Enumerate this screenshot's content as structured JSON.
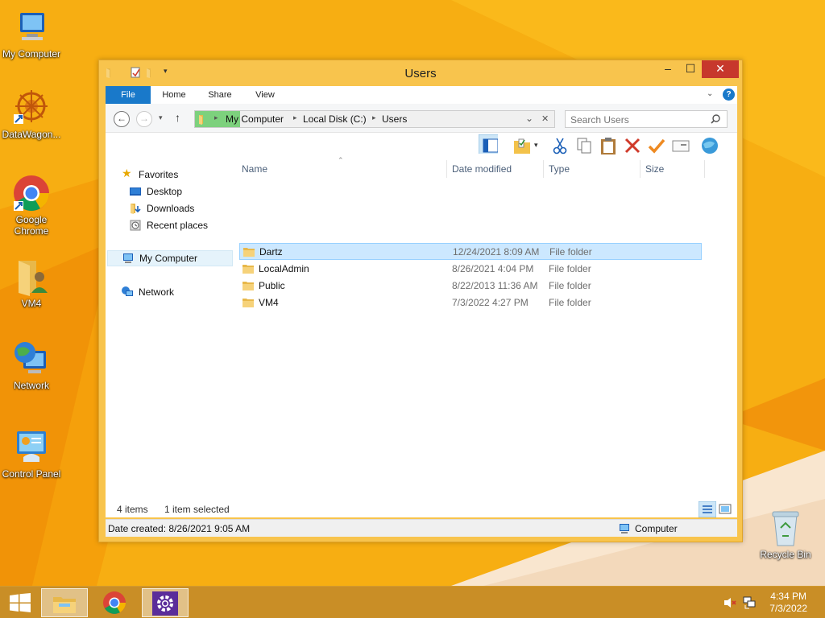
{
  "desktop": {
    "icons": [
      {
        "label": "My Computer",
        "icon": "computer-icon"
      },
      {
        "label": "DataWagon...",
        "icon": "datawagon-icon"
      },
      {
        "label": "Google Chrome",
        "icon": "chrome-icon"
      },
      {
        "label": "VM4",
        "icon": "user-folder-icon"
      },
      {
        "label": "Network",
        "icon": "network-icon"
      },
      {
        "label": "Control Panel",
        "icon": "control-panel-icon"
      },
      {
        "label": "Recycle Bin",
        "icon": "recycle-bin-icon"
      }
    ]
  },
  "window": {
    "title": "Users",
    "ribbon_tabs": [
      "File",
      "Home",
      "Share",
      "View"
    ],
    "address": {
      "crumbs": [
        "My Computer",
        "Local Disk (C:)",
        "Users"
      ]
    },
    "search": {
      "placeholder": "Search Users"
    },
    "nav_pane": {
      "favorites": "Favorites",
      "desktop": "Desktop",
      "downloads": "Downloads",
      "recent": "Recent places",
      "my_computer": "My Computer",
      "network": "Network"
    },
    "columns": [
      "Name",
      "Date modified",
      "Type",
      "Size"
    ],
    "rows": [
      {
        "name": "Dartz",
        "date": "12/24/2021 8:09 AM",
        "type": "File folder",
        "selected": true
      },
      {
        "name": "LocalAdmin",
        "date": "8/26/2021 4:04 PM",
        "type": "File folder",
        "selected": false
      },
      {
        "name": "Public",
        "date": "8/22/2013 11:36 AM",
        "type": "File folder",
        "selected": false
      },
      {
        "name": "VM4",
        "date": "7/3/2022 4:27 PM",
        "type": "File folder",
        "selected": false
      }
    ],
    "status": {
      "count": "4 items",
      "selection": "1 item selected"
    },
    "details": {
      "created": "Date created: 8/26/2021 9:05 AM",
      "location": "Computer"
    }
  },
  "taskbar": {
    "apps": [
      "file-explorer-icon",
      "chrome-icon",
      "settings-icon"
    ],
    "time": "4:34 PM",
    "date": "7/3/2022"
  },
  "colors": {
    "wallpaper": "#f5a80e",
    "window_frame": "#f8c44d",
    "file_tab": "#1979ca",
    "close_button": "#c7382c",
    "selection": "#cce8ff"
  }
}
